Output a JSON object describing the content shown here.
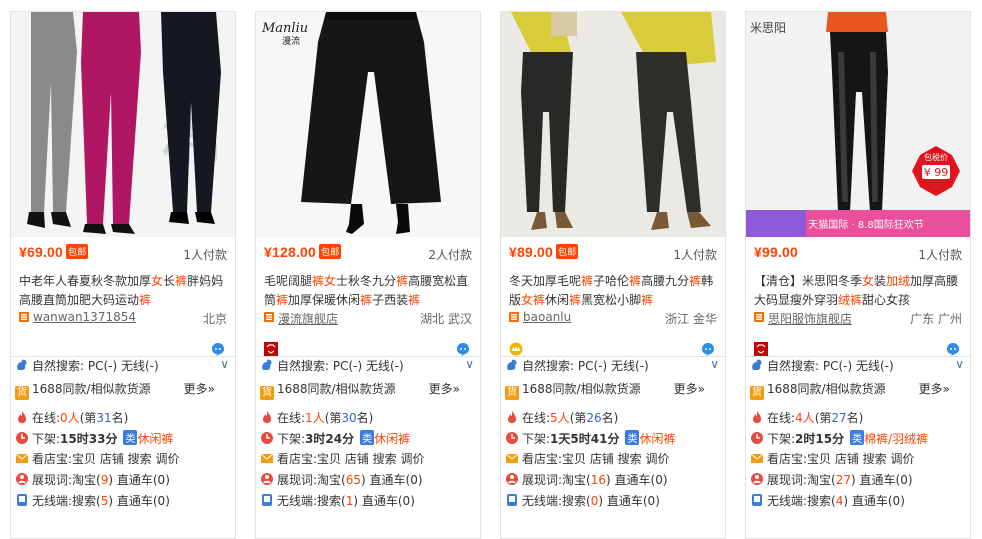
{
  "cards": [
    {
      "price": "¥69.00",
      "baoyou": "包邮",
      "paid": "1人付款",
      "title_parts": [
        {
          "t": "中老年人春夏秋冬款加厚",
          "h": false
        },
        {
          "t": "女",
          "h": true
        },
        {
          "t": "长",
          "h": false
        },
        {
          "t": "裤",
          "h": true
        },
        {
          "t": "胖妈妈高腰直筒加肥大码运动",
          "h": false
        },
        {
          "t": "裤",
          "h": true
        }
      ],
      "shop": "wanwan1371854",
      "location": "北京",
      "shop_icon": "taobao-shop-icon",
      "search": "自然搜索: PC(-) 无线(-)",
      "source": "1688同款/相似款货源",
      "more": "更多»",
      "online_prefix": "在线:",
      "online_count": "0人",
      "online_rank_prefix": "(第",
      "online_rank": "31",
      "online_rank_suffix": "名)",
      "offline_prefix": "下架:",
      "offline_time": "15时33分",
      "category_tag": "类",
      "category": "休闲裤",
      "shop_links": "看店宝:宝贝 店铺 搜索 调价",
      "exposure": "展现词:淘宝(",
      "exposure_num": "9",
      "exposure_tail": ") 直通车(0)",
      "wireless": "无线端:搜索(",
      "wireless_num": "5",
      "wireless_tail": ") 直通车(0)"
    },
    {
      "price": "¥128.00",
      "baoyou": "包邮",
      "paid": "2人付款",
      "title_parts": [
        {
          "t": "毛呢阔腿",
          "h": false
        },
        {
          "t": "裤",
          "h": true
        },
        {
          "t": "女",
          "h": true
        },
        {
          "t": "士秋冬九分",
          "h": false
        },
        {
          "t": "裤",
          "h": true
        },
        {
          "t": "高腰宽松直筒",
          "h": false
        },
        {
          "t": "裤",
          "h": true
        },
        {
          "t": "加厚保暖休闲",
          "h": false
        },
        {
          "t": "裤",
          "h": true
        },
        {
          "t": "子西装",
          "h": false
        },
        {
          "t": "裤",
          "h": true
        }
      ],
      "shop": "漫流旗舰店",
      "location": "湖北 武汉",
      "shop_icon": "tmall-shop-icon",
      "search": "自然搜索: PC(-) 无线(-)",
      "source": "1688同款/相似款货源",
      "more": "更多»",
      "online_prefix": "在线:",
      "online_count": "1人",
      "online_rank_prefix": "(第",
      "online_rank": "30",
      "online_rank_suffix": "名)",
      "offline_prefix": "下架:",
      "offline_time": "3时24分",
      "category_tag": "类",
      "category": "休闲裤",
      "shop_links": "看店宝:宝贝 店铺 搜索 调价",
      "exposure": "展现词:淘宝(",
      "exposure_num": "65",
      "exposure_tail": ") 直通车(0)",
      "wireless": "无线端:搜索(",
      "wireless_num": "1",
      "wireless_tail": ") 直通车(0)"
    },
    {
      "price": "¥89.00",
      "baoyou": "包邮",
      "paid": "1人付款",
      "title_parts": [
        {
          "t": "冬天加厚毛呢",
          "h": false
        },
        {
          "t": "裤",
          "h": true
        },
        {
          "t": "子哈伦",
          "h": false
        },
        {
          "t": "裤",
          "h": true
        },
        {
          "t": "高腰九分",
          "h": false
        },
        {
          "t": "裤",
          "h": true
        },
        {
          "t": "韩版",
          "h": false
        },
        {
          "t": "女裤",
          "h": true
        },
        {
          "t": "休闲",
          "h": false
        },
        {
          "t": "裤",
          "h": true
        },
        {
          "t": "黑宽松小脚",
          "h": false
        },
        {
          "t": "裤",
          "h": true
        }
      ],
      "shop": "baoanlu",
      "location": "浙江 金华",
      "shop_icon": "gold-crown-icon",
      "search": "自然搜索: PC(-) 无线(-)",
      "source": "1688同款/相似款货源",
      "more": "更多»",
      "online_prefix": "在线:",
      "online_count": "5人",
      "online_rank_prefix": "(第",
      "online_rank": "26",
      "online_rank_suffix": "名)",
      "offline_prefix": "下架:",
      "offline_time": "1天5时41分",
      "category_tag": "类",
      "category": "休闲裤",
      "shop_links": "看店宝:宝贝 店铺 搜索 调价",
      "exposure": "展现词:淘宝(",
      "exposure_num": "16",
      "exposure_tail": ") 直通车(0)",
      "wireless": "无线端:搜索(",
      "wireless_num": "0",
      "wireless_tail": ") 直通车(0)"
    },
    {
      "price": "¥99.00",
      "baoyou": "",
      "paid": "1人付款",
      "title_parts": [
        {
          "t": "【清仓】米思阳冬季",
          "h": false
        },
        {
          "t": "女",
          "h": true
        },
        {
          "t": "装",
          "h": false
        },
        {
          "t": "加绒",
          "h": true
        },
        {
          "t": "加厚高腰大码显瘦外穿羽",
          "h": false
        },
        {
          "t": "绒",
          "h": true
        },
        {
          "t": "裤",
          "h": true
        },
        {
          "t": "甜心女孩",
          "h": false
        }
      ],
      "shop": "思阳服饰旗舰店",
      "location": "广东 广州",
      "shop_icon": "tmall-shop-icon",
      "search": "自然搜索: PC(-) 无线(-)",
      "source": "1688同款/相似款货源",
      "more": "更多»",
      "online_prefix": "在线:",
      "online_count": "4人",
      "online_rank_prefix": "(第",
      "online_rank": "27",
      "online_rank_suffix": "名)",
      "offline_prefix": "下架:",
      "offline_time": "2时15分",
      "category_tag": "类",
      "category": "棉裤/羽绒裤",
      "shop_links": "看店宝:宝贝 店铺 搜索 调价",
      "exposure": "展现词:淘宝(",
      "exposure_num": "27",
      "exposure_tail": ") 直通车(0)",
      "wireless": "无线端:搜索(",
      "wireless_num": "4",
      "wireless_tail": ") 直通车(0)"
    }
  ],
  "image_text": {
    "card1_watermark": "棉",
    "card2_brand": "Manliu",
    "card2_brand_cn": "漫流",
    "card4_brand": "米思阳",
    "card4_badge_top": "包税价",
    "card4_badge_price": "¥ 99",
    "card4_banner": "天猫国际 · 8.8国际狂欢节"
  },
  "colors": {
    "price": "#ff4400",
    "link_blue": "#3366cc",
    "border": "#e3e3e3"
  }
}
